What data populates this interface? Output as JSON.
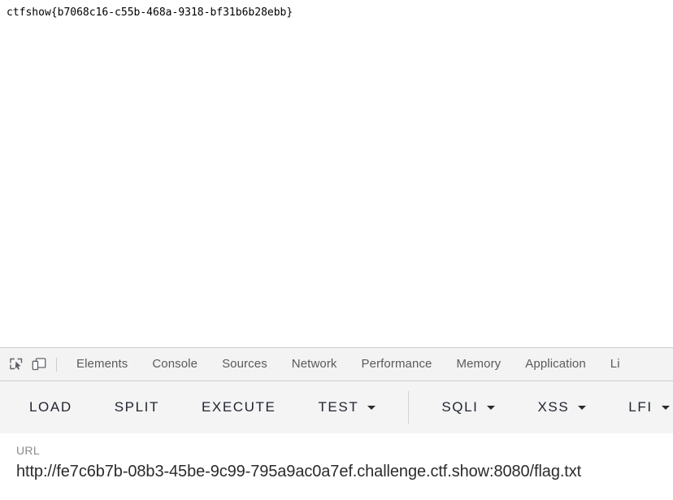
{
  "page": {
    "flag_text": "ctfshow{b7068c16-c55b-468a-9318-bf31b6b28ebb}"
  },
  "devtools": {
    "inspect_icon": "inspect-element-icon",
    "device_toolbar_icon": "device-toolbar-icon",
    "tabs": [
      {
        "label": "Elements",
        "selected": false
      },
      {
        "label": "Console",
        "selected": false
      },
      {
        "label": "Sources",
        "selected": false
      },
      {
        "label": "Network",
        "selected": false
      },
      {
        "label": "Performance",
        "selected": false
      },
      {
        "label": "Memory",
        "selected": false
      },
      {
        "label": "Application",
        "selected": false
      },
      {
        "label": "Li",
        "selected": false
      }
    ]
  },
  "toolbar": {
    "load_label": "LOAD",
    "split_label": "SPLIT",
    "execute_label": "EXECUTE",
    "test_label": "TEST",
    "sqli_label": "SQLI",
    "xss_label": "XSS",
    "lfi_label": "LFI",
    "caret_icon": "chevron-down-icon"
  },
  "url_section": {
    "label": "URL",
    "value": "http://fe7c6b7b-08b3-45be-9c99-795a9ac0a7ef.challenge.ctf.show:8080/flag.txt"
  },
  "colors": {
    "page_background": "#ffffff",
    "devtools_background": "#f3f3f3",
    "toolbar_background": "#f4f4f4",
    "tab_text": "#5a5a5a",
    "button_text": "#1f2430",
    "url_label": "#8a8a8a",
    "url_value": "#2b2b2b",
    "divider": "#cacdd1"
  }
}
